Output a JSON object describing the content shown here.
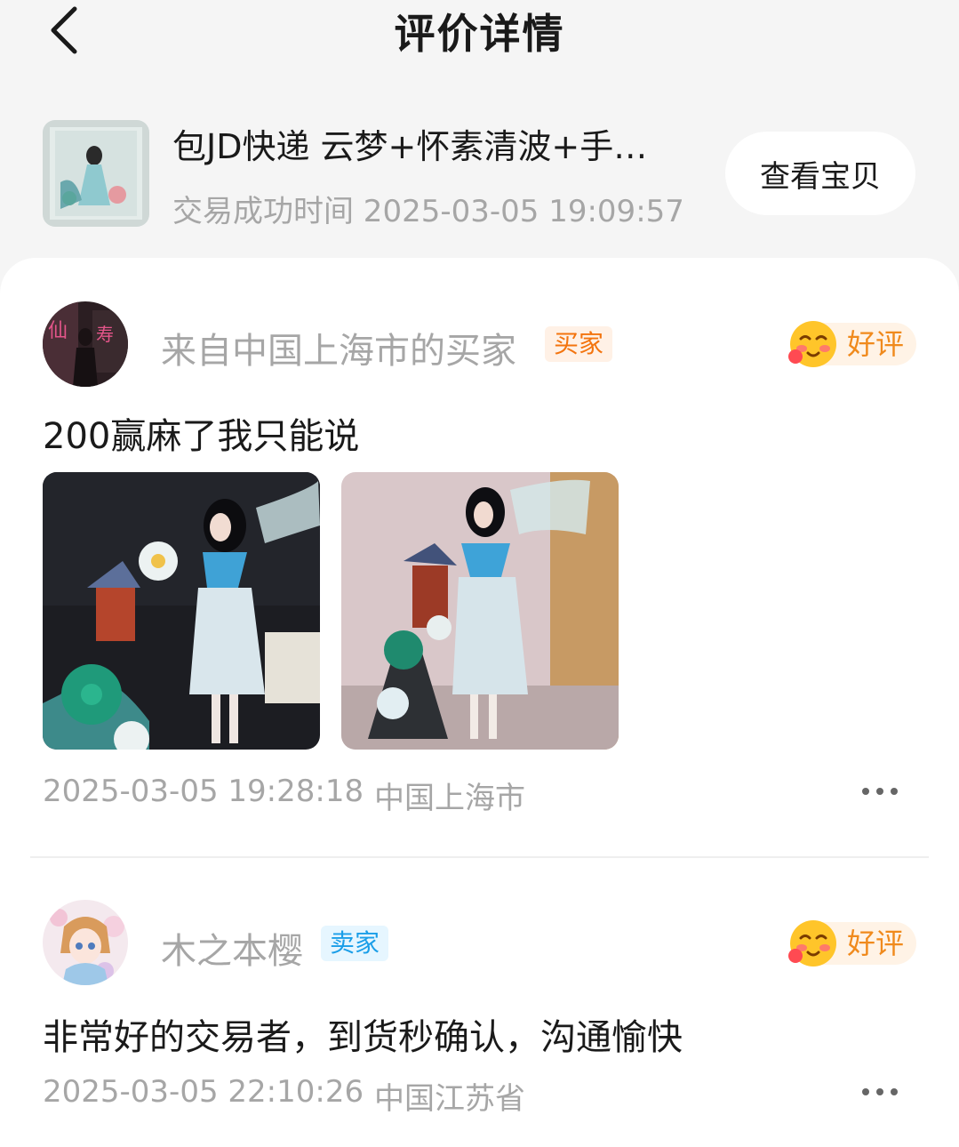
{
  "header": {
    "title": "评价详情",
    "back_icon": "chevron-left-icon"
  },
  "product": {
    "title": "包JD快递 云梦+怀素清波+手…",
    "time_label": "交易成功时间 2025-03-05 19:09:57",
    "view_button": "查看宝贝"
  },
  "reviews": [
    {
      "user": "来自中国上海市的买家",
      "role": "买家",
      "rating": "好评",
      "comment": "200赢麻了我只能说",
      "time": "2025-03-05 19:28:18",
      "location": "中国上海市"
    },
    {
      "user": "木之本樱",
      "role": "卖家",
      "rating": "好评",
      "comment": "非常好的交易者，到货秒确认，沟通愉快",
      "time": "2025-03-05 22:10:26",
      "location": "中国江苏省"
    }
  ],
  "colors": {
    "buyer_badge": "#f3740e",
    "seller_badge": "#1a9ee8",
    "rating_text": "#f08a1c",
    "secondary_text": "#a6a6a6"
  }
}
